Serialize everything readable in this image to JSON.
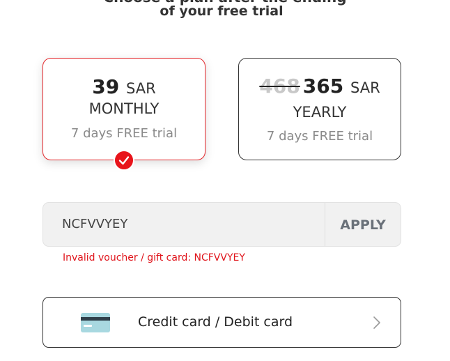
{
  "heading": {
    "line1": "Choose a plan after the ending",
    "line2": "of your free trial"
  },
  "plans": {
    "monthly": {
      "price": "39",
      "currency": "SAR",
      "period": "MONTHLY",
      "trial": "7 days FREE trial",
      "selected": true
    },
    "yearly": {
      "old_price": "468",
      "price": "365",
      "currency": "SAR",
      "period": "YEARLY",
      "trial": "7 days FREE trial",
      "selected": false
    }
  },
  "voucher": {
    "value": "NCFVVYEY",
    "apply_label": "APPLY",
    "error": "Invalid voucher / gift card: NCFVVYEY"
  },
  "payment": {
    "label": "Credit card / Debit card",
    "icon": "credit-card-icon"
  },
  "colors": {
    "accent_red": "#e8141b",
    "text_dark": "#222222",
    "muted_gray": "#8a8a8a",
    "card_icon": "#a8d8e0"
  }
}
